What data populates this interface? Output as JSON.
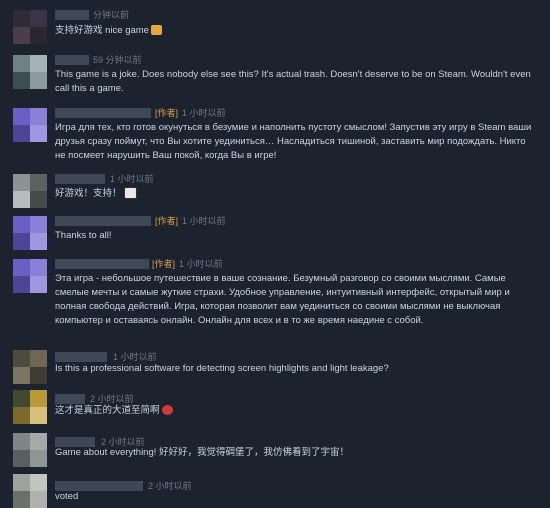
{
  "author_tag": "[作者]",
  "comments": [
    {
      "time": "分钟以前",
      "text": "支持好游戏 nice game",
      "emoticon": "cat-emoticon"
    },
    {
      "time": "59 分钟以前",
      "text": "This game is a joke. Does nobody else see this? It's actual trash. Doesn't deserve to be on Steam. Wouldn't even call this a game."
    },
    {
      "time": "1 小时以前",
      "author": true,
      "text": "Игра для тех, кто готов окунуться в безумие и наполнить пустоту смыслом! Запустив эту игру в Steam ваши друзья сразу поймут, что Вы хотите уединиться… Насладиться тишиной, заставить мир подождать. Никто не посмеет нарушить Ваш покой, когда Вы в игре!"
    },
    {
      "time": "1 小时以前",
      "text": "好游戏！支持！",
      "emoticon": "panda-emoticon"
    },
    {
      "time": "1 小时以前",
      "author": true,
      "text": "Thanks to all!"
    },
    {
      "time": "1 小时以前",
      "author": true,
      "text": "Эта игра - небольшое путешествие в ваше сознание. Безумный разговор со своими мыслями. Самые смелые мечты и самые жуткие страхи. Удобное управление, интуитивный интерфейс, открытый мир и полная свобода действий. Игра, которая позволит вам уединиться со своими мыслями не выключая компьютер и оставаясь онлайн. Онлайн для всех и в то же время наедине с собой."
    },
    {
      "time": "1 小时以前",
      "text": "Is this a professional software for detecting screen highlights and light leakage?"
    },
    {
      "time": "2 小时以前",
      "text": "这才是真正的大道至简啊",
      "emoticon": "red-emoticon"
    },
    {
      "time": "2 小时以前",
      "text": "Game about everything! 好好好，我觉得碉堡了，我仿佛看到了宇宙！"
    },
    {
      "time": "2 小时以前",
      "text": "voted"
    }
  ]
}
